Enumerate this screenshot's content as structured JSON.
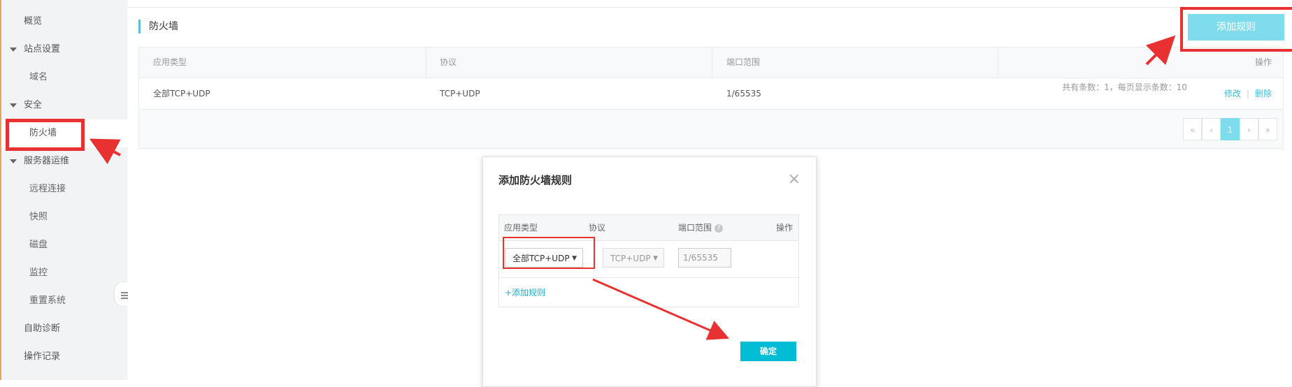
{
  "sidebar": {
    "overview": "概览",
    "site_settings": "站点设置",
    "domain": "域名",
    "security": "安全",
    "firewall": "防火墙",
    "server_ops": "服务器运维",
    "remote": "远程连接",
    "snapshot": "快照",
    "disk": "磁盘",
    "monitor": "监控",
    "reset": "重置系统",
    "diagnose": "自助诊断",
    "logs": "操作记录"
  },
  "main": {
    "section_title": "防火墙",
    "add_rule_button": "添加规则",
    "table": {
      "headers": [
        "应用类型",
        "协议",
        "端口范围",
        "操作"
      ],
      "row": {
        "app_type": "全部TCP+UDP",
        "protocol": "TCP+UDP",
        "port": "1/65535",
        "edit": "修改",
        "sep": "|",
        "delete": "删除"
      }
    },
    "pager": {
      "info": "共有条数：1，每页显示条数：10",
      "first": "«",
      "prev": "‹",
      "current": "1",
      "next": "›",
      "last": "»"
    }
  },
  "dialog": {
    "title": "添加防火墙规则",
    "close": "×",
    "headers": {
      "app_type": "应用类型",
      "protocol": "协议",
      "port": "端口范围",
      "help": "?",
      "op": "操作"
    },
    "row": {
      "app_type": "全部TCP+UDP",
      "protocol": "TCP+UDP",
      "port": "1/65535",
      "arrow": "▼"
    },
    "add_rule_link": "+添加规则",
    "confirm": "确定"
  },
  "colors": {
    "accent": "#7edcec",
    "confirm": "#00bcd4",
    "annotation": "#e83232"
  }
}
